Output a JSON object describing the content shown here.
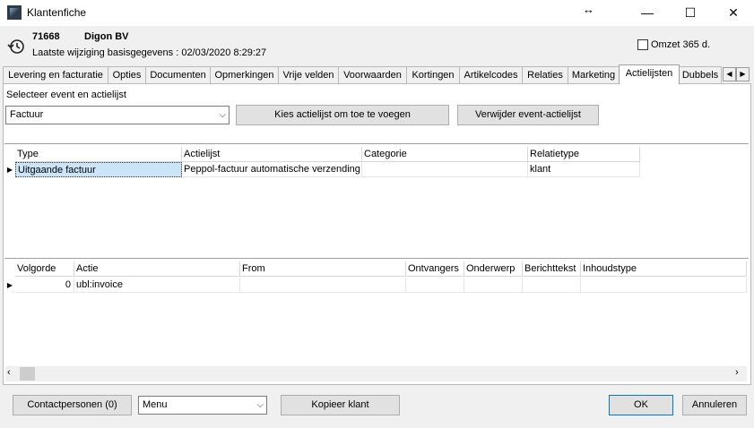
{
  "window": {
    "title": "Klantenfiche",
    "resize_icon": "↔",
    "minimize": "—",
    "maximize": "☐",
    "close": "✕"
  },
  "header": {
    "customer_number": "71668",
    "customer_name": "Digon BV",
    "last_change": "Laatste wijziging basisgegevens  :  02/03/2020 8:29:27",
    "omzet_label": "Omzet 365 d."
  },
  "tabs": [
    {
      "label": "Levering en facturatie"
    },
    {
      "label": "Opties"
    },
    {
      "label": "Documenten"
    },
    {
      "label": "Opmerkingen"
    },
    {
      "label": "Vrije velden"
    },
    {
      "label": "Voorwaarden"
    },
    {
      "label": "Kortingen"
    },
    {
      "label": "Artikelcodes"
    },
    {
      "label": "Relaties"
    },
    {
      "label": "Marketing"
    },
    {
      "label": "Actielijsten"
    },
    {
      "label": "Dubbels"
    }
  ],
  "active_tab": "Actielijsten",
  "event_section": {
    "label": "Selecteer event en actielijst",
    "event_value": "Factuur",
    "add_button": "Kies actielijst om toe te voegen",
    "remove_button": "Verwijder event-actielijst"
  },
  "top_grid": {
    "columns": [
      "Type",
      "Actielijst",
      "Categorie",
      "Relatietype"
    ],
    "rows": [
      [
        "Uitgaande factuur",
        "Peppol-factuur automatische verzending",
        "",
        "klant"
      ]
    ]
  },
  "bottom_grid": {
    "columns": [
      "Volgorde",
      "Actie",
      "From",
      "Ontvangers",
      "Onderwerp",
      "Berichttekst",
      "Inhoudstype"
    ],
    "rows": [
      [
        "0",
        "ubl:invoice",
        "",
        "",
        "",
        "",
        ""
      ]
    ]
  },
  "footer": {
    "contacts_button": "Contactpersonen (0)",
    "menu_value": "Menu",
    "copy_button": "Kopieer klant",
    "ok_button": "OK",
    "cancel_button": "Annuleren"
  },
  "icons": {
    "row_indicator": "▶",
    "scroll_left": "‹",
    "scroll_right": "›",
    "dropdown": "⌵"
  }
}
